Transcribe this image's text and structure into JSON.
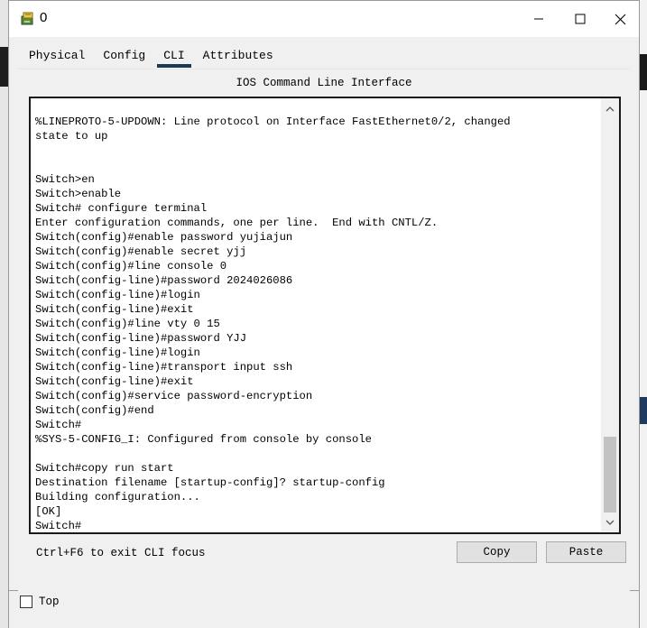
{
  "window": {
    "title": "0",
    "minimize_icon": "minimize-icon",
    "maximize_icon": "maximize-icon",
    "close_icon": "close-icon"
  },
  "tabs": [
    {
      "label": "Physical",
      "active": false
    },
    {
      "label": "Config",
      "active": false
    },
    {
      "label": "CLI",
      "active": true
    },
    {
      "label": "Attributes",
      "active": false
    }
  ],
  "cli": {
    "heading": "IOS Command Line Interface",
    "lines": [
      "%LINEPROTO-5-UPDOWN: Line protocol on Interface FastEthernet0/2, changed",
      "state to up",
      "",
      "",
      "Switch>en",
      "Switch>enable",
      "Switch# configure terminal",
      "Enter configuration commands, one per line.  End with CNTL/Z.",
      "Switch(config)#enable password yujiajun",
      "Switch(config)#enable secret yjj",
      "Switch(config)#line console 0",
      "Switch(config-line)#password 2024026086",
      "Switch(config-line)#login",
      "Switch(config-line)#exit",
      "Switch(config)#line vty 0 15",
      "Switch(config-line)#password YJJ",
      "Switch(config-line)#login",
      "Switch(config-line)#transport input ssh",
      "Switch(config-line)#exit",
      "Switch(config)#service password-encryption",
      "Switch(config)#end",
      "Switch#",
      "%SYS-5-CONFIG_I: Configured from console by console",
      "",
      "Switch#copy run start",
      "Destination filename [startup-config]? startup-config",
      "Building configuration...",
      "[OK]",
      "Switch#"
    ],
    "hint": "Ctrl+F6 to exit CLI focus",
    "copy_label": "Copy",
    "paste_label": "Paste"
  },
  "footer": {
    "top_label": "Top",
    "top_checked": false
  }
}
